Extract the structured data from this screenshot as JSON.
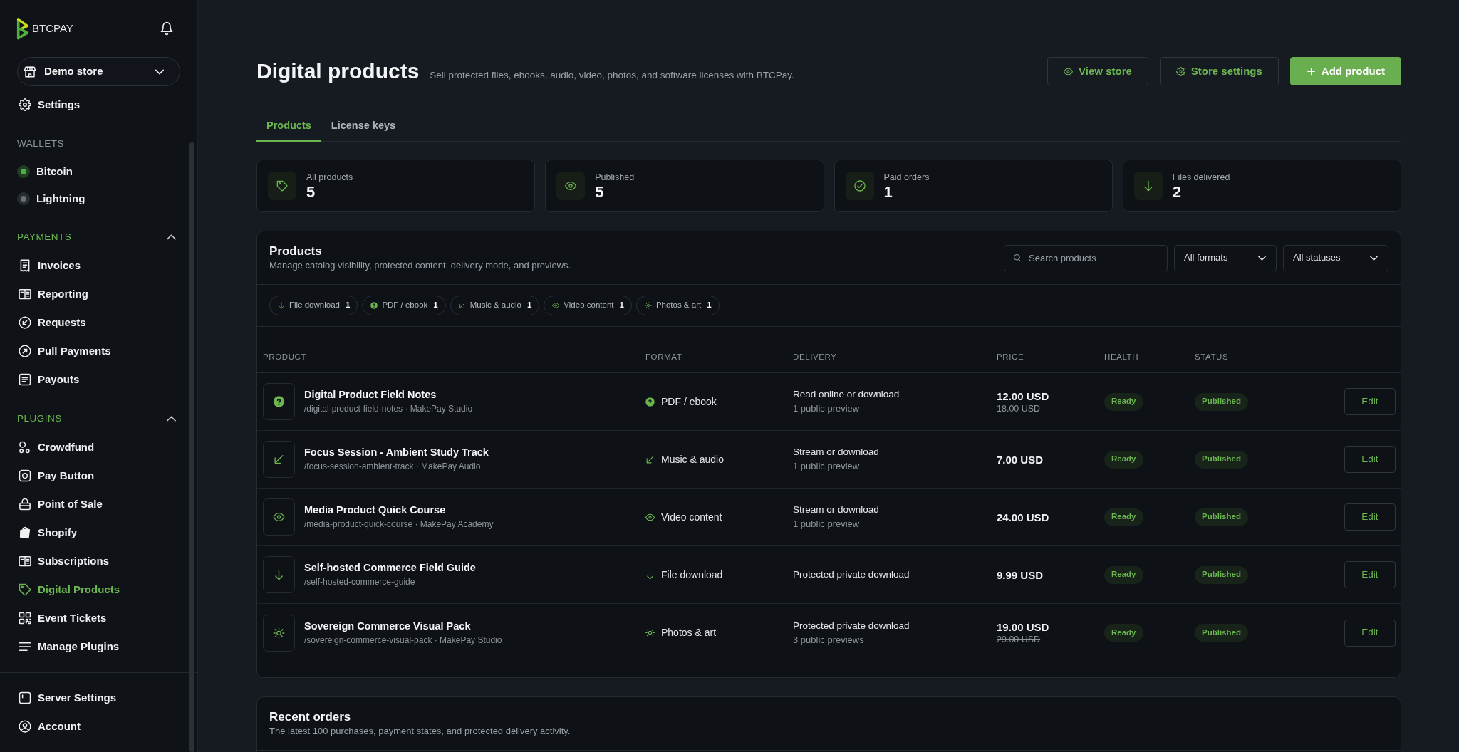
{
  "sidebar": {
    "logo": "BTCPAY",
    "store_selector": {
      "value": "Demo store"
    },
    "top_items": [
      {
        "kind": "settings",
        "label": "Settings",
        "selected": false
      }
    ],
    "sections": [
      {
        "kind": "static",
        "title": "WALLETS",
        "items": [
          {
            "kind": "wallet",
            "label": "Bitcoin",
            "color": "#4fae45",
            "selected": false
          },
          {
            "kind": "wallet",
            "label": "Lightning",
            "color": "#6b6f76",
            "selected": false
          }
        ]
      },
      {
        "kind": "collapsible",
        "title": "PAYMENTS",
        "expanded": true,
        "items": [
          {
            "kind": "invoices",
            "label": "Invoices",
            "selected": false
          },
          {
            "kind": "reporting",
            "label": "Reporting",
            "selected": false
          },
          {
            "kind": "requests",
            "label": "Requests",
            "selected": false
          },
          {
            "kind": "pull",
            "label": "Pull Payments",
            "selected": false
          },
          {
            "kind": "payouts",
            "label": "Payouts",
            "selected": false
          }
        ]
      },
      {
        "kind": "collapsible",
        "title": "PLUGINS",
        "expanded": true,
        "items": [
          {
            "kind": "crowdfund",
            "label": "Crowdfund",
            "selected": false
          },
          {
            "kind": "paybutton",
            "label": "Pay Button",
            "selected": false
          },
          {
            "kind": "pos",
            "label": "Point of Sale",
            "selected": false
          },
          {
            "kind": "shopify",
            "label": "Shopify",
            "selected": false
          },
          {
            "kind": "subscriptions",
            "label": "Subscriptions",
            "selected": false
          },
          {
            "kind": "products",
            "label": "Digital Products",
            "selected": true
          },
          {
            "kind": "tickets",
            "label": "Event Tickets",
            "selected": false
          },
          {
            "kind": "plugins",
            "label": "Manage Plugins",
            "selected": false
          }
        ]
      }
    ],
    "bottom_items": [
      {
        "kind": "server",
        "label": "Server Settings",
        "selected": false
      },
      {
        "kind": "account",
        "label": "Account",
        "selected": false
      }
    ]
  },
  "header": {
    "title": "Digital products",
    "subtitle": "Sell protected files, ebooks, audio, video, photos, and software licenses with BTCPay.",
    "buttons": [
      {
        "kind": "view",
        "label": "View store"
      },
      {
        "kind": "settings",
        "label": "Store settings"
      },
      {
        "kind": "add",
        "label": "Add product"
      }
    ]
  },
  "tabs": [
    {
      "label": "Products",
      "selected": true
    },
    {
      "label": "License keys",
      "selected": false
    }
  ],
  "stats": [
    {
      "kind": "tag",
      "label": "All products",
      "value": "5"
    },
    {
      "kind": "eye",
      "label": "Published",
      "value": "5"
    },
    {
      "kind": "check",
      "label": "Paid orders",
      "value": "1"
    },
    {
      "kind": "download",
      "label": "Files delivered",
      "value": "2"
    }
  ],
  "products": {
    "title": "Products",
    "subtitle": "Manage catalog visibility, protected content, delivery mode, and previews.",
    "search": {
      "placeholder": "Search products"
    },
    "filters": [
      {
        "value": "All formats"
      },
      {
        "value": "All statuses"
      }
    ],
    "format_chips": [
      {
        "kind": "file",
        "label": "File download",
        "count": "1"
      },
      {
        "kind": "ebook",
        "label": "PDF / ebook",
        "count": "1"
      },
      {
        "kind": "audio",
        "label": "Music & audio",
        "count": "1"
      },
      {
        "kind": "video",
        "label": "Video content",
        "count": "1"
      },
      {
        "kind": "photos",
        "label": "Photos & art",
        "count": "1"
      }
    ],
    "table": {
      "columns": [
        "PRODUCT",
        "FORMAT",
        "DELIVERY",
        "PRICE",
        "HEALTH",
        "STATUS"
      ],
      "rows": [
        {
          "name": "Digital Product Field Notes",
          "details": "/digital-product-field-notes · MakePay Studio",
          "format": {
            "kind": "ebook",
            "label": "PDF / ebook"
          },
          "delivery": "Read online or download",
          "previews": "1 public preview",
          "price": "12.00 USD",
          "compare_price": "18.00 USD",
          "health": "Ready",
          "status": "Published",
          "action": "Edit"
        },
        {
          "name": "Focus Session - Ambient Study Track",
          "details": "/focus-session-ambient-track · MakePay Audio",
          "format": {
            "kind": "audio",
            "label": "Music & audio"
          },
          "delivery": "Stream or download",
          "previews": "1 public preview",
          "price": "7.00 USD",
          "health": "Ready",
          "status": "Published",
          "action": "Edit"
        },
        {
          "name": "Media Product Quick Course",
          "details": "/media-product-quick-course · MakePay Academy",
          "format": {
            "kind": "video",
            "label": "Video content"
          },
          "delivery": "Stream or download",
          "previews": "1 public preview",
          "price": "24.00 USD",
          "health": "Ready",
          "status": "Published",
          "action": "Edit"
        },
        {
          "name": "Self-hosted Commerce Field Guide",
          "details": "/self-hosted-commerce-guide",
          "format": {
            "kind": "file",
            "label": "File download"
          },
          "delivery": "Protected private download",
          "price": "9.99 USD",
          "health": "Ready",
          "status": "Published",
          "action": "Edit"
        },
        {
          "name": "Sovereign Commerce Visual Pack",
          "details": "/sovereign-commerce-visual-pack · MakePay Studio",
          "format": {
            "kind": "photos",
            "label": "Photos & art"
          },
          "delivery": "Protected private download",
          "previews": "3 public previews",
          "price": "19.00 USD",
          "compare_price": "29.00 USD",
          "health": "Ready",
          "status": "Published",
          "action": "Edit"
        }
      ]
    }
  },
  "recent_orders": {
    "title": "Recent orders",
    "subtitle": "The latest 100 purchases, payment states, and protected delivery activity."
  }
}
